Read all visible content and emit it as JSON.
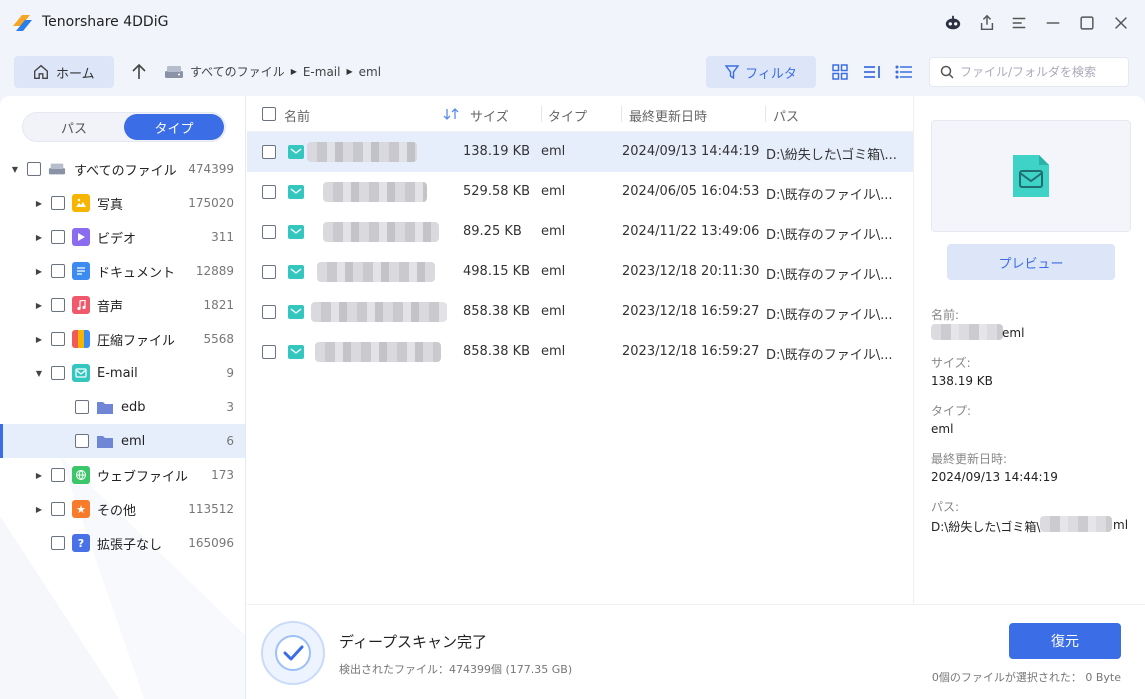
{
  "app": {
    "title": "Tenorshare 4DDiG"
  },
  "toolbar": {
    "home_label": "ホーム",
    "breadcrumbs": [
      "すべてのファイル",
      "E-mail",
      "eml"
    ],
    "filter_label": "フィルタ",
    "search_placeholder": "ファイル/フォルダを検索"
  },
  "sidebar": {
    "tabs": [
      {
        "label": "パス"
      },
      {
        "label": "タイプ"
      }
    ],
    "active_tab": "タイプ",
    "tree": [
      {
        "label": "すべてのファイル",
        "count": "474399"
      },
      {
        "label": "写真",
        "count": "175020"
      },
      {
        "label": "ビデオ",
        "count": "311"
      },
      {
        "label": "ドキュメント",
        "count": "12889"
      },
      {
        "label": "音声",
        "count": "1821"
      },
      {
        "label": "圧縮ファイル",
        "count": "5568"
      },
      {
        "label": "E-mail",
        "count": "9"
      },
      {
        "label": "edb",
        "count": "3"
      },
      {
        "label": "eml",
        "count": "6"
      },
      {
        "label": "ウェブファイル",
        "count": "173"
      },
      {
        "label": "その他",
        "count": "113512"
      },
      {
        "label": "拡張子なし",
        "count": "165096"
      }
    ]
  },
  "table": {
    "columns": [
      "名前",
      "サイズ",
      "タイプ",
      "最終更新日時",
      "パス"
    ],
    "rows": [
      {
        "size": "138.19 KB",
        "type": "eml",
        "modified": "2024/09/13 14:44:19",
        "path": "D:\\紛失した\\ゴミ箱\\..."
      },
      {
        "size": "529.58 KB",
        "type": "eml",
        "modified": "2024/06/05 16:04:53",
        "path": "D:\\既存のファイル\\..."
      },
      {
        "size": "89.25 KB",
        "type": "eml",
        "modified": "2024/11/22 13:49:06",
        "path": "D:\\既存のファイル\\..."
      },
      {
        "size": "498.15 KB",
        "type": "eml",
        "modified": "2023/12/18 20:11:30",
        "path": "D:\\既存のファイル\\..."
      },
      {
        "size": "858.38 KB",
        "type": "eml",
        "modified": "2023/12/18 16:59:27",
        "path": "D:\\既存のファイル\\..."
      },
      {
        "size": "858.38 KB",
        "type": "eml",
        "modified": "2023/12/18 16:59:27",
        "path": "D:\\既存のファイル\\..."
      }
    ]
  },
  "preview": {
    "button_label": "プレビュー",
    "name_label": "名前:",
    "name_value_suffix": "eml",
    "size_label": "サイズ:",
    "size_value": "138.19 KB",
    "type_label": "タイプ:",
    "type_value": "eml",
    "modified_label": "最終更新日時:",
    "modified_value": "2024/09/13 14:44:19",
    "path_label": "パス:",
    "path_value_prefix": "D:\\紛失した\\ゴミ箱\\",
    "path_value_suffix": "ml"
  },
  "status": {
    "title": "ディープスキャン完了",
    "detected": "検出されたファイル：474399個 (177.35 GB)",
    "restore_label": "復元",
    "selection_info": "0個のファイルが選択された： 0 Byte"
  },
  "colors": {
    "accent": "#3b6ee6",
    "accent_light": "#dde6f8",
    "mail_icon": "#34c7c0"
  }
}
